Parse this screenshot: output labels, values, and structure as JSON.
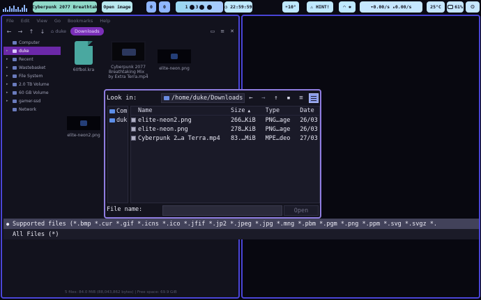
{
  "topbar": {
    "media_title": "Cyberpunk 2077 Breathtak",
    "open_image": "Open image",
    "workspace_left": "0",
    "workspace_right": "0",
    "ws1": "1",
    "ws3": "3",
    "clock": "22:59:59",
    "weather": "10°",
    "hint": "HINT!",
    "net_down": "0.00/s",
    "net_up": "0.00/s",
    "temp": "25°C",
    "battery": "61%"
  },
  "file_manager": {
    "menu": [
      "File",
      "Edit",
      "View",
      "Go",
      "Bookmarks",
      "Help"
    ],
    "crumb_home": "duke",
    "crumb_current": "Downloads",
    "sidebar": [
      {
        "label": "Computer",
        "caret": "",
        "selected": false
      },
      {
        "label": "duke",
        "caret": "▸",
        "selected": true
      },
      {
        "label": "Recent",
        "caret": "▸",
        "selected": false
      },
      {
        "label": "Wastebasket",
        "caret": "▸",
        "selected": false
      },
      {
        "label": "File System",
        "caret": "▸",
        "selected": false
      },
      {
        "label": "2.0 TB Volume",
        "caret": "▸",
        "selected": false
      },
      {
        "label": "60 GB Volume",
        "caret": "▸",
        "selected": false
      },
      {
        "label": "gamer-ssd",
        "caret": "▸",
        "selected": false
      },
      {
        "label": "Network",
        "caret": "",
        "selected": false
      }
    ],
    "files": {
      "kra": "60fbol.kra",
      "video_l1": "Cyberpunk 2077",
      "video_l2": "Breathtaking Mix _",
      "video_l3": "by Extra Terra.mp4",
      "neon": "elite-neon.png",
      "neon2": "elite-neon2.png"
    },
    "status": "5 files: 84.0 MiB (88,043,862 bytes)  |  Free space: 69.9 GiB"
  },
  "dialog": {
    "look_in_label": "Look in:",
    "path": "/home/duke/Downloads",
    "places": [
      {
        "label": "Com"
      },
      {
        "label": "duk"
      }
    ],
    "columns": {
      "name": "Name",
      "size": "Size",
      "type": "Type",
      "date": "Date"
    },
    "rows": [
      {
        "name": "elite-neon2.png",
        "size": "266…KiB",
        "type": "PNG…age",
        "date": "26/03"
      },
      {
        "name": "elite-neon.png",
        "size": "278…KiB",
        "type": "PNG…age",
        "date": "26/03"
      },
      {
        "name": "Cyberpunk 2…a Terra.mp4",
        "size": "83.…MiB",
        "type": "MPE…deo",
        "date": "27/03"
      }
    ],
    "filename_label": "File name:",
    "filename_value": "",
    "open_label": "Open"
  },
  "filters": [
    {
      "label": "Supported files (*.bmp *.cur *.gif *.icns *.ico *.jfif *.jp2 *.jpeg *.jpg *.mng *.pbm *.pgm *.png *.ppm *.svg *.svgz *.",
      "selected": true
    },
    {
      "label": "All Files (*)",
      "selected": false
    }
  ]
}
